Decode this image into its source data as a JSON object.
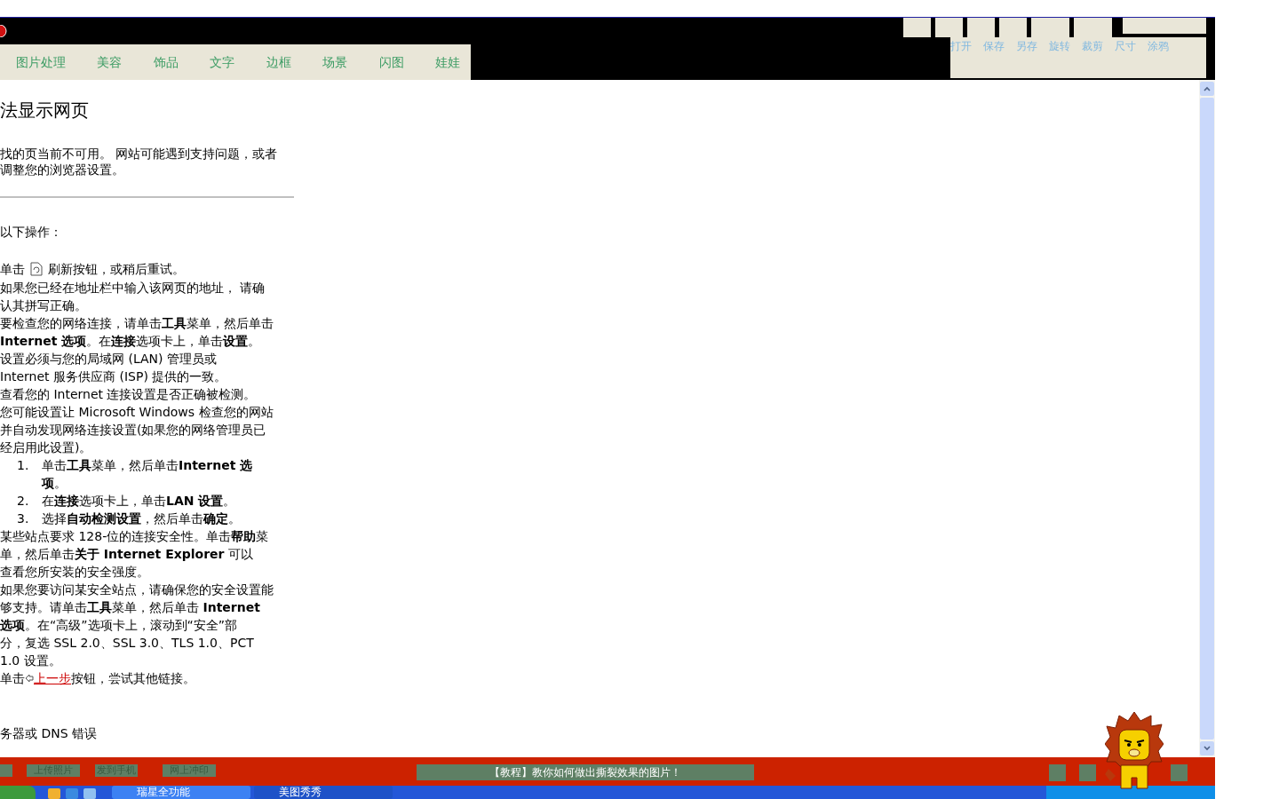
{
  "header": {
    "tabs": [
      "图片处理",
      "美容",
      "饰品",
      "文字",
      "边框",
      "场景",
      "闪图",
      "娃娃"
    ],
    "tools": [
      "打开",
      "保存",
      "另存",
      "旋转",
      "裁剪",
      "尺寸",
      "涂鸦"
    ]
  },
  "error_page": {
    "title": "法显示网页",
    "intro": [
      "找的页当前不可用。 网站可能遇到支持问题，或者",
      "调整您的浏览器设置。"
    ],
    "lead": "以下操作：",
    "refresh": {
      "before": "单击",
      "after": "刷新按钮，或稍后重试。"
    },
    "lines_a": [
      "如果您已经在地址栏中输入该网页的地址， 请确",
      "认其拼写正确。",
      "要检查您的网络连接，请单击**工具**菜单，然后单击",
      "**Internet 选项**。在**连接**选项卡上，单击**设置**。",
      "设置必须与您的局域网 (LAN) 管理员或",
      "Internet 服务供应商 (ISP) 提供的一致。",
      "查看您的 Internet 连接设置是否正确被检测。",
      "您可能设置让 Microsoft Windows 检查您的网站",
      "并自动发现网络连接设置(如果您的网络管理员已",
      "经启用此设置)。"
    ],
    "steps": [
      {
        "number": "1.",
        "lines": [
          "单击**工具**菜单，然后单击**Internet 选**",
          "**项**。"
        ]
      },
      {
        "number": "2.",
        "lines": [
          "在**连接**选项卡上，单击**LAN 设置**。"
        ]
      },
      {
        "number": "3.",
        "lines": [
          "选择**自动检测设置**，然后单击**确定**。"
        ]
      }
    ],
    "lines_b": [
      "某些站点要求 128-位的连接安全性。单击**帮助**菜",
      "单，然后单击**关于 Internet Explorer** 可以",
      "查看您所安装的安全强度。",
      "如果您要访问某安全站点，请确保您的安全设置能",
      "够支持。请单击**工具**菜单，然后单击 **Internet**",
      "**选项**。在“高级”选项卡上，滚动到“安全”部",
      "分，复选 SSL 2.0、SSL 3.0、TLS 1.0、PCT",
      "1.0 设置。"
    ],
    "back": {
      "before": "单击",
      "link": "上一步",
      "after": "按钮，尝试其他链接。"
    },
    "footer_line": "务器或 DNS 错误"
  },
  "bottom_bar": {
    "buttons": [
      "上传照片",
      "发到手机",
      "网上冲印"
    ],
    "banner": "【教程】教你如何做出撕裂效果的图片！"
  },
  "taskbar": {
    "tasks": [
      "瑞星全功能",
      "美图秀秀"
    ]
  }
}
